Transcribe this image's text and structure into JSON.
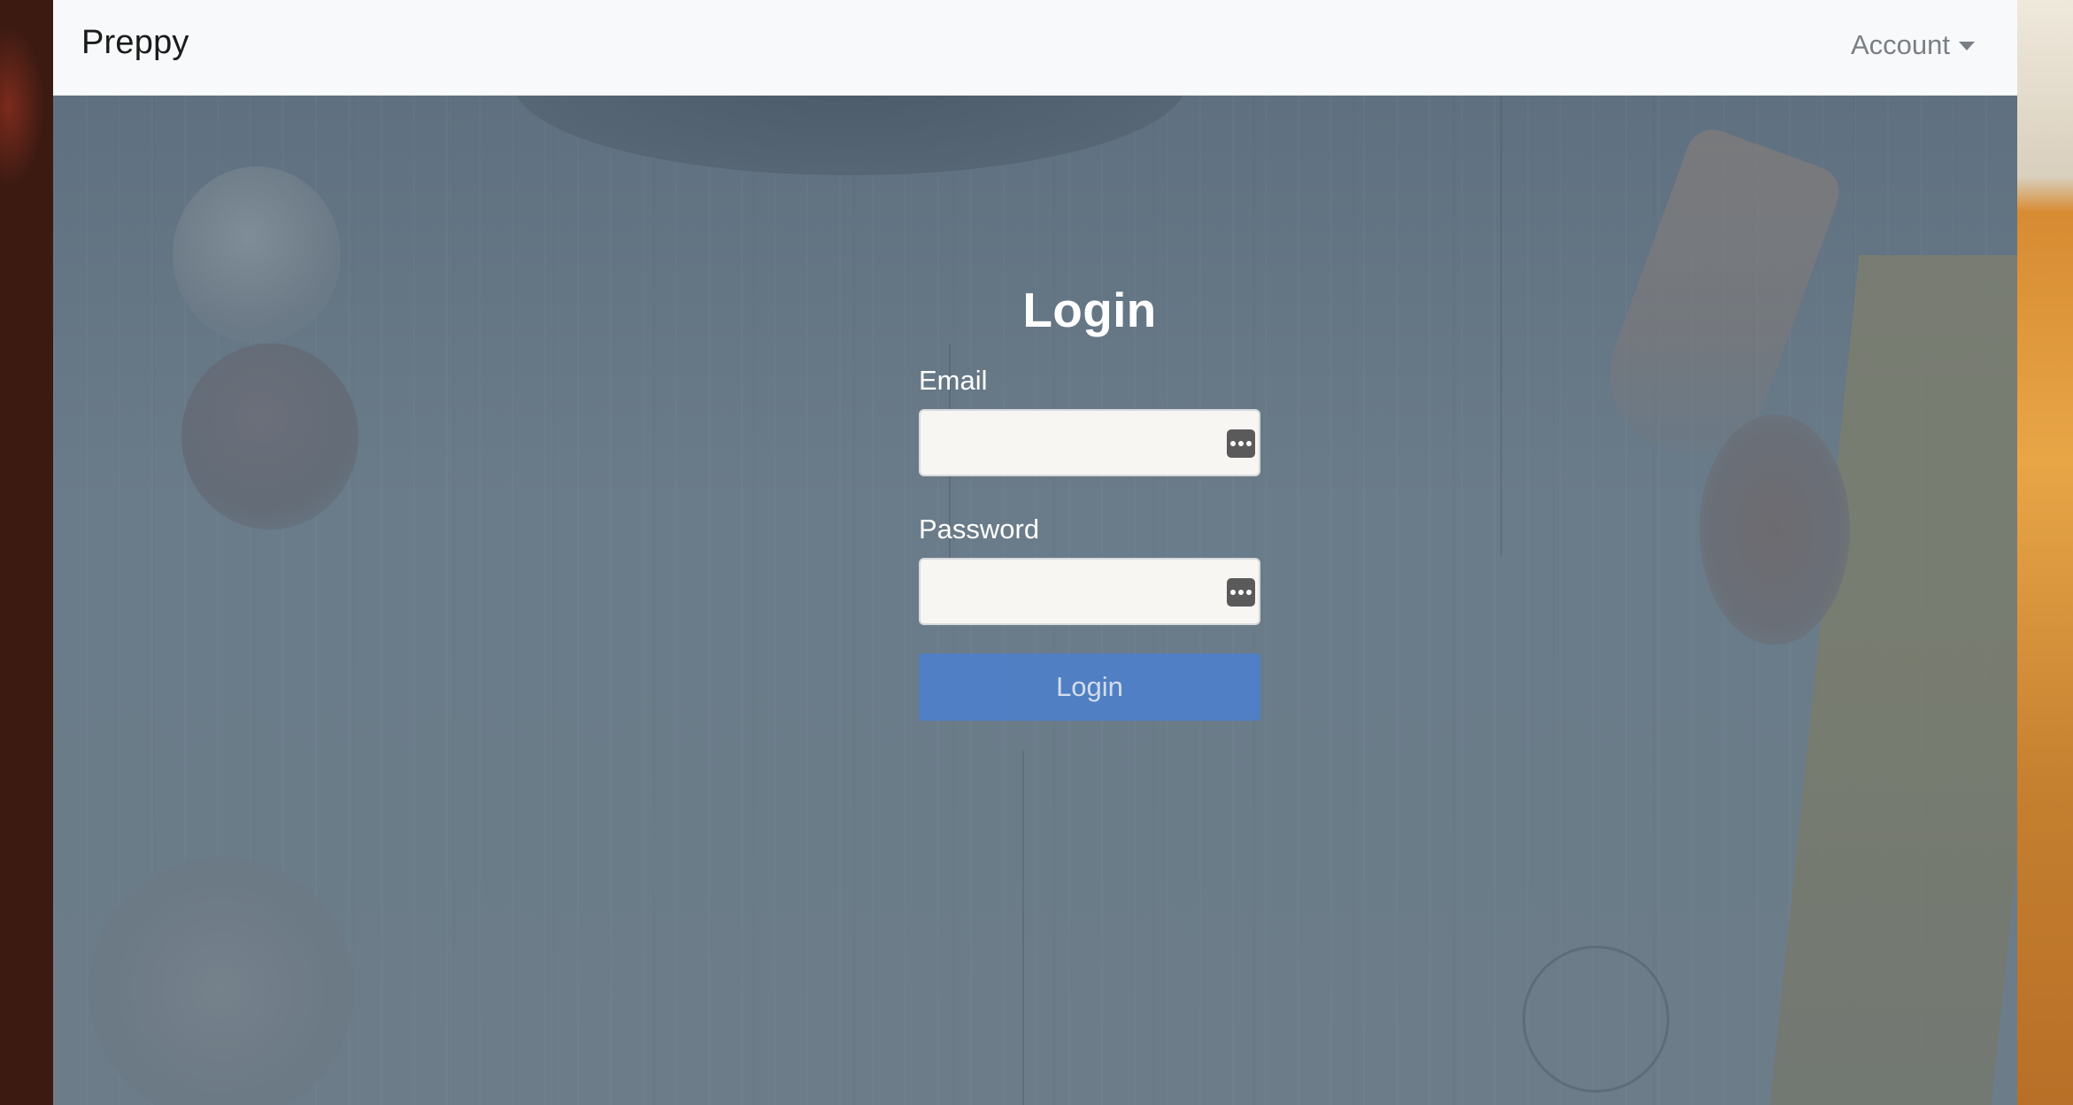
{
  "navbar": {
    "brand": "Preppy",
    "account_label": "Account"
  },
  "login": {
    "title": "Login",
    "email_label": "Email",
    "email_value": "",
    "password_label": "Password",
    "password_value": "",
    "submit_label": "Login"
  },
  "colors": {
    "navbar_bg": "#f8f9fa",
    "content_overlay": "#6a7b89",
    "button_primary": "#4f80c8"
  },
  "icons": {
    "password_manager": "keychain-autofill-icon",
    "dropdown": "caret-down-icon"
  }
}
